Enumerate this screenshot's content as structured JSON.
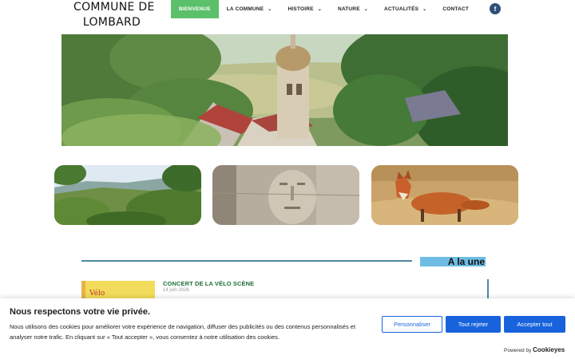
{
  "header": {
    "title_line1": "COMMUNE DE",
    "title_line2": "LOMBARD",
    "nav": [
      {
        "label": "BIENVENUE",
        "active": true
      },
      {
        "label": "LA COMMUNE",
        "dropdown": true
      },
      {
        "label": "HISTOIRE",
        "dropdown": true
      },
      {
        "label": "NATURE",
        "dropdown": true
      },
      {
        "label": "ACTUALITÉS",
        "dropdown": true
      },
      {
        "label": "CONTACT"
      }
    ],
    "social_icon": "facebook-icon",
    "social_glyph": "f",
    "dropdown_glyph": "⌄"
  },
  "featured": {
    "heading": "A la une",
    "post": {
      "title": "CONCERT DE LA VÉLO SCÈNE",
      "date": "14 juin 2026",
      "thumb_text": "Vélo"
    }
  },
  "cookie": {
    "title": "Nous respectons votre vie privée.",
    "text": "Nous utilisons des cookies pour améliorer votre expérience de navigation, diffuser des publicités ou des contenus personnalisés et analyser notre trafic. En cliquant sur « Tout accepter », vous consentez à notre utilisation des cookies.",
    "customize_label": "Personnaliser",
    "reject_label": "Tout rejeter",
    "accept_label": "Accepter tout",
    "powered_prefix": "Powered by ",
    "powered_brand": "Cookieyes"
  },
  "colors": {
    "nav_active": "#5cc06a",
    "accent_blue": "#1863dc",
    "une_line": "#4e8aa4",
    "une_tag": "#6fbde4",
    "post_title": "#1f6f3a"
  }
}
